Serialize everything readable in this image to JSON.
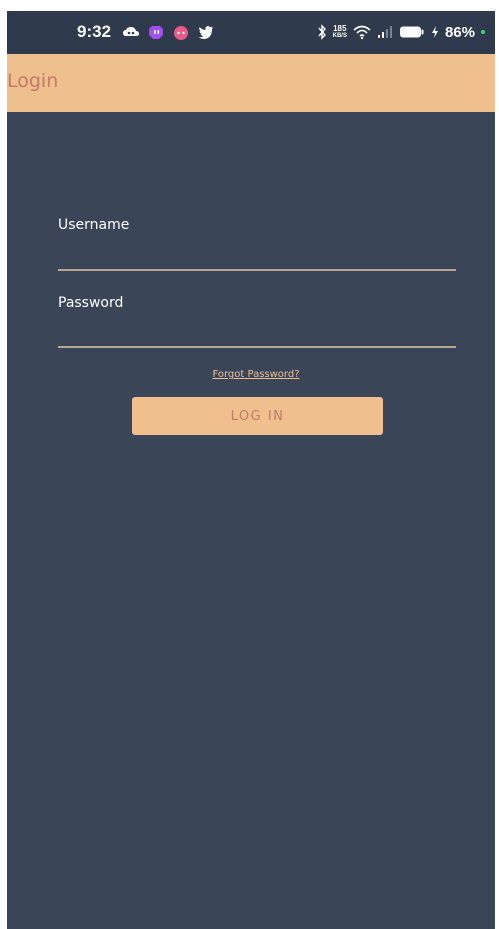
{
  "status_bar": {
    "time": "9:32",
    "notification_icons": [
      "cloud-icon",
      "twitch-icon",
      "reddit-icon",
      "twitter-icon"
    ],
    "net_speed_value": "185",
    "net_speed_unit": "KB/S",
    "battery_percent": "86%",
    "icons": [
      "bluetooth-icon",
      "wifi-icon",
      "signal-icon",
      "battery-icon",
      "charging-icon"
    ]
  },
  "app_bar": {
    "title": "Login"
  },
  "form": {
    "username_label": "Username",
    "username_value": "",
    "password_label": "Password",
    "password_value": "",
    "forgot_password": "Forgot Password?",
    "login_button": "LOG IN"
  },
  "colors": {
    "background": "#3a4658",
    "status_bar": "#2f3b4c",
    "accent": "#f0bf8e",
    "accent_text": "#c47a6a",
    "input_underline": "#b9a592"
  }
}
